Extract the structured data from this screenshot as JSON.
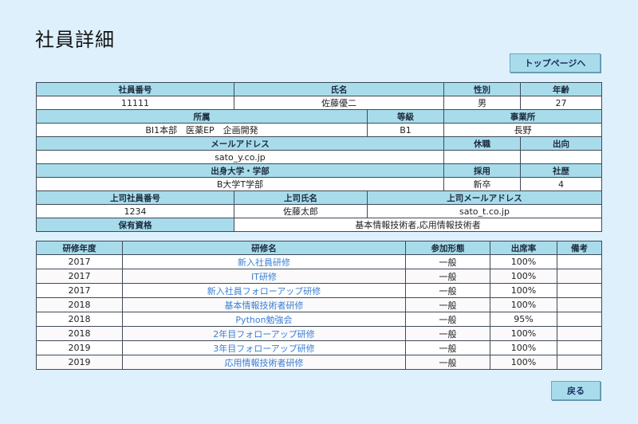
{
  "page": {
    "title": "社員詳細",
    "top_button": "トップページへ",
    "back_button": "戻る"
  },
  "employee": {
    "labels": {
      "id": "社員番号",
      "name": "氏名",
      "gender": "性別",
      "age": "年齢",
      "department": "所属",
      "grade": "等級",
      "office": "事業所",
      "email": "メールアドレス",
      "leave": "休職",
      "secondment": "出向",
      "school": "出身大学・学部",
      "hire_type": "採用",
      "tenure": "社歴",
      "boss_id": "上司社員番号",
      "boss_name": "上司氏名",
      "boss_email": "上司メールアドレス",
      "qualifications": "保有資格"
    },
    "values": {
      "id": "11111",
      "name": "佐藤優二",
      "gender": "男",
      "age": "27",
      "department": "BI1本部　医薬EP　企画開発",
      "grade": "B1",
      "office": "長野",
      "email": "sato_y.co.jp",
      "leave": "",
      "secondment": "",
      "school": "B大学T学部",
      "hire_type": "新卒",
      "tenure": "4",
      "boss_id": "1234",
      "boss_name": "佐藤太郎",
      "boss_email": "sato_t.co.jp",
      "qualifications": "基本情報技術者,応用情報技術者"
    }
  },
  "training": {
    "headers": {
      "year": "研修年度",
      "name": "研修名",
      "form": "参加形態",
      "attendance": "出席率",
      "note": "備考"
    },
    "rows": [
      {
        "year": "2017",
        "name": "新入社員研修",
        "form": "一般",
        "attendance": "100%",
        "note": ""
      },
      {
        "year": "2017",
        "name": "IT研修",
        "form": "一般",
        "attendance": "100%",
        "note": ""
      },
      {
        "year": "2017",
        "name": "新入社員フォローアップ研修",
        "form": "一般",
        "attendance": "100%",
        "note": ""
      },
      {
        "year": "2018",
        "name": "基本情報技術者研修",
        "form": "一般",
        "attendance": "100%",
        "note": ""
      },
      {
        "year": "2018",
        "name": "Python勉強会",
        "form": "一般",
        "attendance": "95%",
        "note": ""
      },
      {
        "year": "2018",
        "name": "2年目フォローアップ研修",
        "form": "一般",
        "attendance": "100%",
        "note": ""
      },
      {
        "year": "2019",
        "name": "3年目フォローアップ研修",
        "form": "一般",
        "attendance": "100%",
        "note": ""
      },
      {
        "year": "2019",
        "name": "応用情報技術者研修",
        "form": "一般",
        "attendance": "100%",
        "note": ""
      }
    ]
  }
}
